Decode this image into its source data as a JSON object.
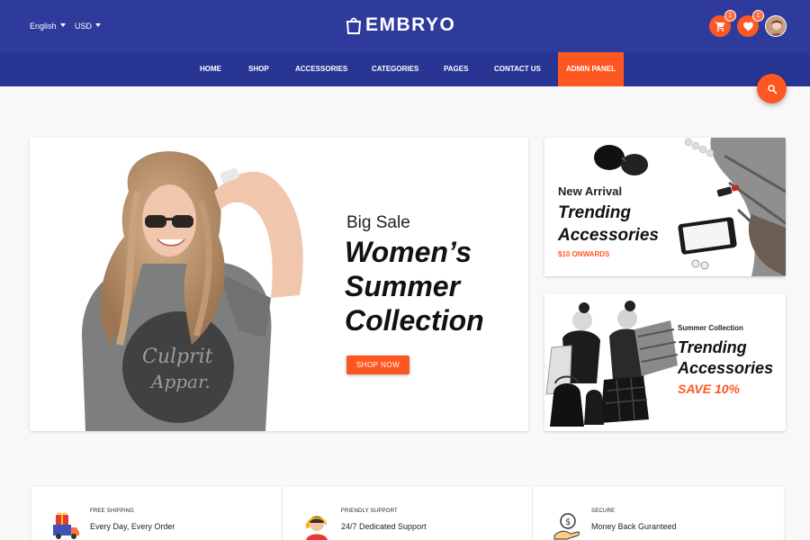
{
  "header": {
    "language": "English",
    "currency": "USD",
    "logo": "EMBRYO",
    "cart_count": "1",
    "wishlist_count": "1",
    "icons": [
      "cart-icon",
      "heart-icon",
      "avatar"
    ]
  },
  "nav": {
    "items": [
      "HOME",
      "SHOP",
      "ACCESSORIES",
      "CATEGORIES",
      "PAGES",
      "CONTACT US"
    ],
    "admin": "ADMIN PANEL"
  },
  "hero": {
    "subtitle": "Big Sale",
    "title": "Women’s Summer Collection",
    "button": "SHOP NOW"
  },
  "promos": [
    {
      "subtitle": "New Arrival",
      "title": "Trending Accessories",
      "tag": "$10 ONWARDS"
    },
    {
      "subtitle": "Summer Collection",
      "title": "Trending Accessories",
      "tag": "SAVE 10%"
    }
  ],
  "features": [
    {
      "label": "FREE SHIPPING",
      "text": "Every Day, Every Order",
      "icon": "gift-truck-icon"
    },
    {
      "label": "FRIENDLY SUPPORT",
      "text": "24/7 Dedicated Support",
      "icon": "support-agent-icon"
    },
    {
      "label": "SECURE",
      "text": "Money Back Guranteed",
      "icon": "money-back-icon"
    }
  ],
  "colors": {
    "header": "#2f3b9c",
    "nav": "#283593",
    "accent": "#ff5722"
  }
}
